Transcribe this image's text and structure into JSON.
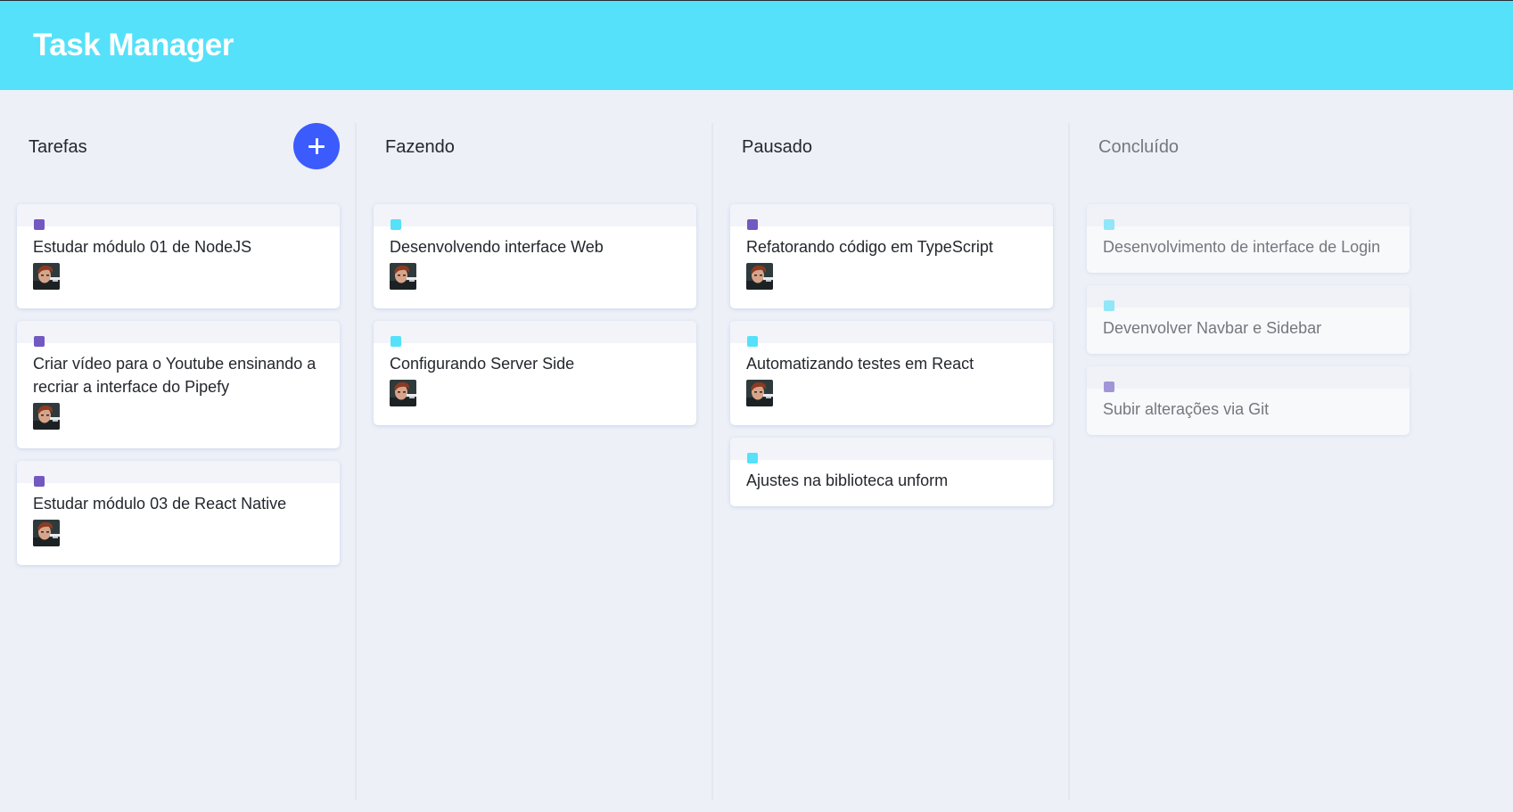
{
  "app": {
    "title": "Task Manager"
  },
  "colors": {
    "header": "#55e1f9",
    "background": "#edf0f7",
    "add_button": "#3b5bfd",
    "label_purple": "#7159c1",
    "label_cyan": "#55e1f9"
  },
  "lists": [
    {
      "title": "Tarefas",
      "add_button_icon": "plus-icon",
      "cards": [
        {
          "content": "Estudar módulo 01 de NodeJS",
          "label_color": "#7159c1",
          "has_avatar": true
        },
        {
          "content": "Criar vídeo para o Youtube ensinando a recriar a interface do Pipefy",
          "label_color": "#7159c1",
          "has_avatar": true
        },
        {
          "content": "Estudar módulo 03 de React Native",
          "label_color": "#7159c1",
          "has_avatar": true
        }
      ]
    },
    {
      "title": "Fazendo",
      "cards": [
        {
          "content": "Desenvolvendo interface Web",
          "label_color": "#55e1f9",
          "has_avatar": true
        },
        {
          "content": "Configurando Server Side",
          "label_color": "#55e1f9",
          "has_avatar": true
        }
      ]
    },
    {
      "title": "Pausado",
      "cards": [
        {
          "content": "Refatorando código em TypeScript",
          "label_color": "#7159c1",
          "has_avatar": true
        },
        {
          "content": "Automatizando testes em React",
          "label_color": "#55e1f9",
          "has_avatar": true
        },
        {
          "content": "Ajustes na biblioteca unform",
          "label_color": "#55e1f9",
          "has_avatar": false
        }
      ]
    },
    {
      "title": "Concluído",
      "cards": [
        {
          "content": "Desenvolvimento de interface de Login",
          "label_color": "#55e1f9",
          "has_avatar": false
        },
        {
          "content": "Devenvolver Navbar e Sidebar",
          "label_color": "#55e1f9",
          "has_avatar": false
        },
        {
          "content": "Subir alterações via Git",
          "label_color": "#7159c1",
          "has_avatar": false
        }
      ]
    }
  ]
}
